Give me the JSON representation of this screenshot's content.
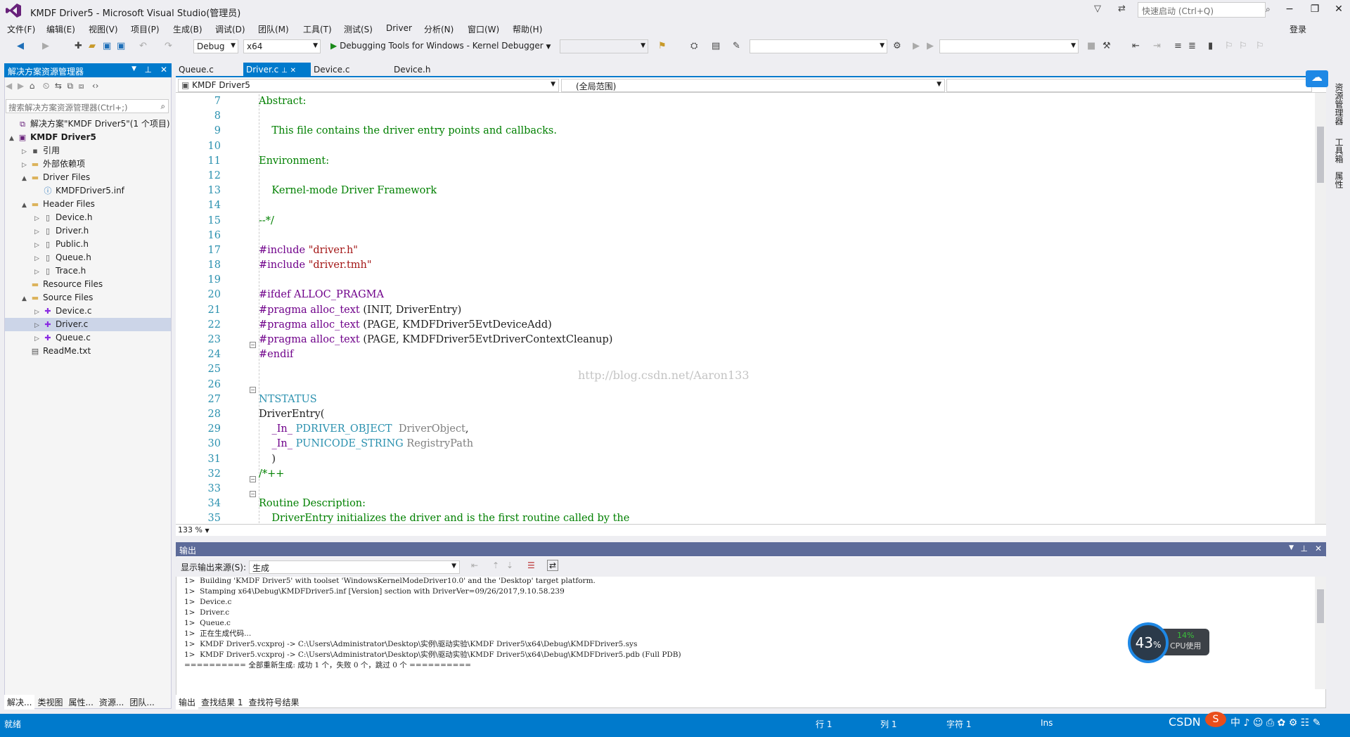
{
  "window": {
    "title": "KMDF Driver5 - Microsoft Visual Studio(管理员)",
    "quick_launch_placeholder": "快速启动 (Ctrl+Q)",
    "login": "登录"
  },
  "menu": [
    "文件(F)",
    "编辑(E)",
    "视图(V)",
    "项目(P)",
    "生成(B)",
    "调试(D)",
    "团队(M)",
    "工具(T)",
    "测试(S)",
    "Driver",
    "分析(N)",
    "窗口(W)",
    "帮助(H)"
  ],
  "toolbar": {
    "config": "Debug",
    "platform": "x64",
    "debugger": "Debugging Tools for Windows - Kernel Debugger"
  },
  "solution_explorer": {
    "title": "解决方案资源管理器",
    "search_placeholder": "搜索解决方案资源管理器(Ctrl+;)",
    "items": [
      {
        "label": "解决方案\"KMDF Driver5\"(1 个项目)",
        "level": 0,
        "icon": "solution-icon",
        "twisty": ""
      },
      {
        "label": "KMDF Driver5",
        "level": 0,
        "icon": "project-icon",
        "twisty": "▲",
        "bold": true
      },
      {
        "label": "引用",
        "level": 1,
        "icon": "references-icon",
        "twisty": "▷"
      },
      {
        "label": "外部依赖项",
        "level": 1,
        "icon": "folder-icon",
        "twisty": "▷"
      },
      {
        "label": "Driver Files",
        "level": 1,
        "icon": "folder-icon",
        "twisty": "▲"
      },
      {
        "label": "KMDFDriver5.inf",
        "level": 2,
        "icon": "info-file-icon",
        "twisty": ""
      },
      {
        "label": "Header Files",
        "level": 1,
        "icon": "folder-icon",
        "twisty": "▲"
      },
      {
        "label": "Device.h",
        "level": 2,
        "icon": "header-file-icon",
        "twisty": "▷"
      },
      {
        "label": "Driver.h",
        "level": 2,
        "icon": "header-file-icon",
        "twisty": "▷"
      },
      {
        "label": "Public.h",
        "level": 2,
        "icon": "header-file-icon",
        "twisty": "▷"
      },
      {
        "label": "Queue.h",
        "level": 2,
        "icon": "header-file-icon",
        "twisty": "▷"
      },
      {
        "label": "Trace.h",
        "level": 2,
        "icon": "header-file-icon",
        "twisty": "▷"
      },
      {
        "label": "Resource Files",
        "level": 1,
        "icon": "folder-icon",
        "twisty": ""
      },
      {
        "label": "Source Files",
        "level": 1,
        "icon": "folder-icon",
        "twisty": "▲"
      },
      {
        "label": "Device.c",
        "level": 2,
        "icon": "cpp-file-icon",
        "twisty": "▷"
      },
      {
        "label": "Driver.c",
        "level": 2,
        "icon": "cpp-file-icon",
        "twisty": "▷",
        "selected": true
      },
      {
        "label": "Queue.c",
        "level": 2,
        "icon": "cpp-file-icon",
        "twisty": "▷"
      },
      {
        "label": "ReadMe.txt",
        "level": 1,
        "icon": "text-file-icon",
        "twisty": ""
      }
    ],
    "bottom_tabs": [
      "解决...",
      "类视图",
      "属性...",
      "资源...",
      "团队..."
    ]
  },
  "editor": {
    "tabs": [
      "Queue.c",
      "Driver.c",
      "Device.c",
      "Device.h"
    ],
    "active_tab": "Driver.c",
    "nav_project": "KMDF Driver5",
    "nav_scope": "(全局范围)",
    "zoom": "133 %",
    "watermark": "http://blog.csdn.net/Aaron133",
    "line_numbers": [
      "7",
      "8",
      "9",
      "10",
      "11",
      "12",
      "13",
      "14",
      "15",
      "16",
      "17",
      "18",
      "19",
      "20",
      "21",
      "22",
      "23",
      "24",
      "25",
      "26",
      "27",
      "28",
      "29",
      "30",
      "31",
      "32",
      "33",
      "34",
      "35"
    ]
  },
  "output": {
    "title": "输出",
    "source_label": "显示输出来源(S):",
    "source_value": "生成",
    "lines": [
      "1>  Building 'KMDF Driver5' with toolset 'WindowsKernelModeDriver10.0' and the 'Desktop' target platform.",
      "1>  Stamping x64\\Debug\\KMDFDriver5.inf [Version] section with DriverVer=09/26/2017,9.10.58.239",
      "1>  Device.c",
      "1>  Driver.c",
      "1>  Queue.c",
      "1>  正在生成代码...",
      "1>  KMDF Driver5.vcxproj -> C:\\Users\\Administrator\\Desktop\\实例\\驱动实验\\KMDF Driver5\\x64\\Debug\\KMDFDriver5.sys",
      "1>  KMDF Driver5.vcxproj -> C:\\Users\\Administrator\\Desktop\\实例\\驱动实验\\KMDF Driver5\\x64\\Debug\\KMDFDriver5.pdb (Full PDB)",
      "========== 全部重新生成: 成功 1 个，失败 0 个，跳过 0 个 =========="
    ],
    "tabs": [
      "输出",
      "查找结果 1",
      "查找符号结果"
    ]
  },
  "cpu": {
    "percent": "43",
    "unit": "%",
    "mem": "14%",
    "label": "CPU使用"
  },
  "right_rail": [
    "资源管理器",
    "工具箱",
    "属性"
  ],
  "status": {
    "ready": "就绪",
    "line": "行 1",
    "col": "列 1",
    "char": "字符 1",
    "ins": "Ins",
    "csdn": "CSDN"
  }
}
